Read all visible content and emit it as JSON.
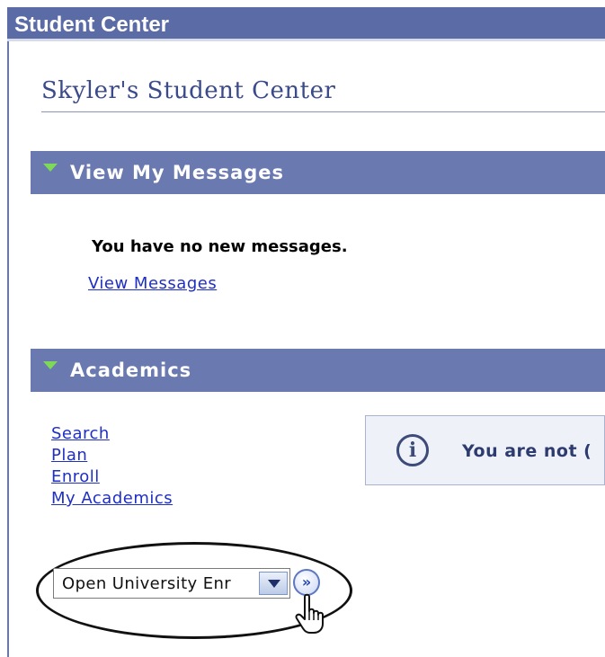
{
  "window": {
    "title": "Student Center"
  },
  "page": {
    "title": "Skyler's Student Center"
  },
  "sections": {
    "messages": {
      "header": "View My Messages",
      "status_text": "You have no new messages.",
      "link": "View Messages"
    },
    "academics": {
      "header": "Academics",
      "links": [
        "Search",
        "Plan",
        "Enroll",
        "My Academics"
      ],
      "info_text": "You are not (",
      "dropdown": {
        "selected": "Open University Enr"
      },
      "go_button": "»"
    }
  },
  "icons": {
    "section_toggle": "triangle-down-icon",
    "info": "info-icon",
    "cursor": "hand-pointer-icon"
  },
  "colors": {
    "title_bar": "#5b6ba5",
    "section_bar": "#6a79b0",
    "link": "#1f2fc4",
    "toggle": "#7ed957"
  }
}
